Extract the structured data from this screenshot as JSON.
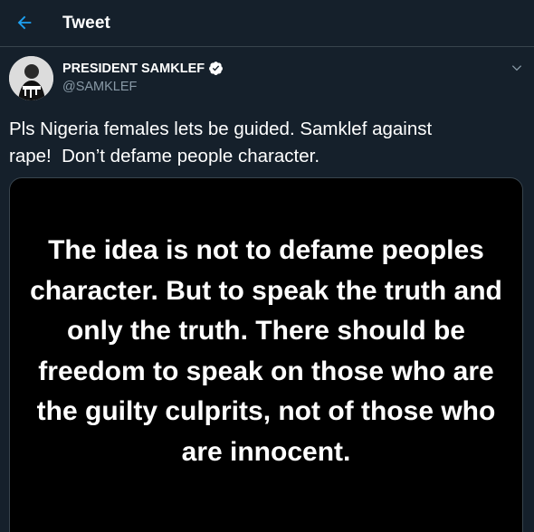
{
  "header": {
    "title": "Tweet",
    "back_icon": "back-arrow-icon",
    "accent_color": "#1da1f2"
  },
  "tweet": {
    "author_name": "PRESIDENT SAMKLEF",
    "author_handle": "@SAMKLEF",
    "verified_icon": "verified-badge-icon",
    "caret_icon": "chevron-down-icon",
    "text": "Pls Nigeria females lets be guided. Samklef against\nrape!  Don’t defame people character.",
    "image_text": "The idea is not to defame peoples\ncharacter. But to speak the truth and\nonly the truth. There should be\nfreedom to speak on those who are\nthe guilty culprits, not of those who\nare innocent."
  },
  "colors": {
    "background": "#15202b",
    "secondary_text": "#8899a6",
    "divider": "#38444d"
  }
}
